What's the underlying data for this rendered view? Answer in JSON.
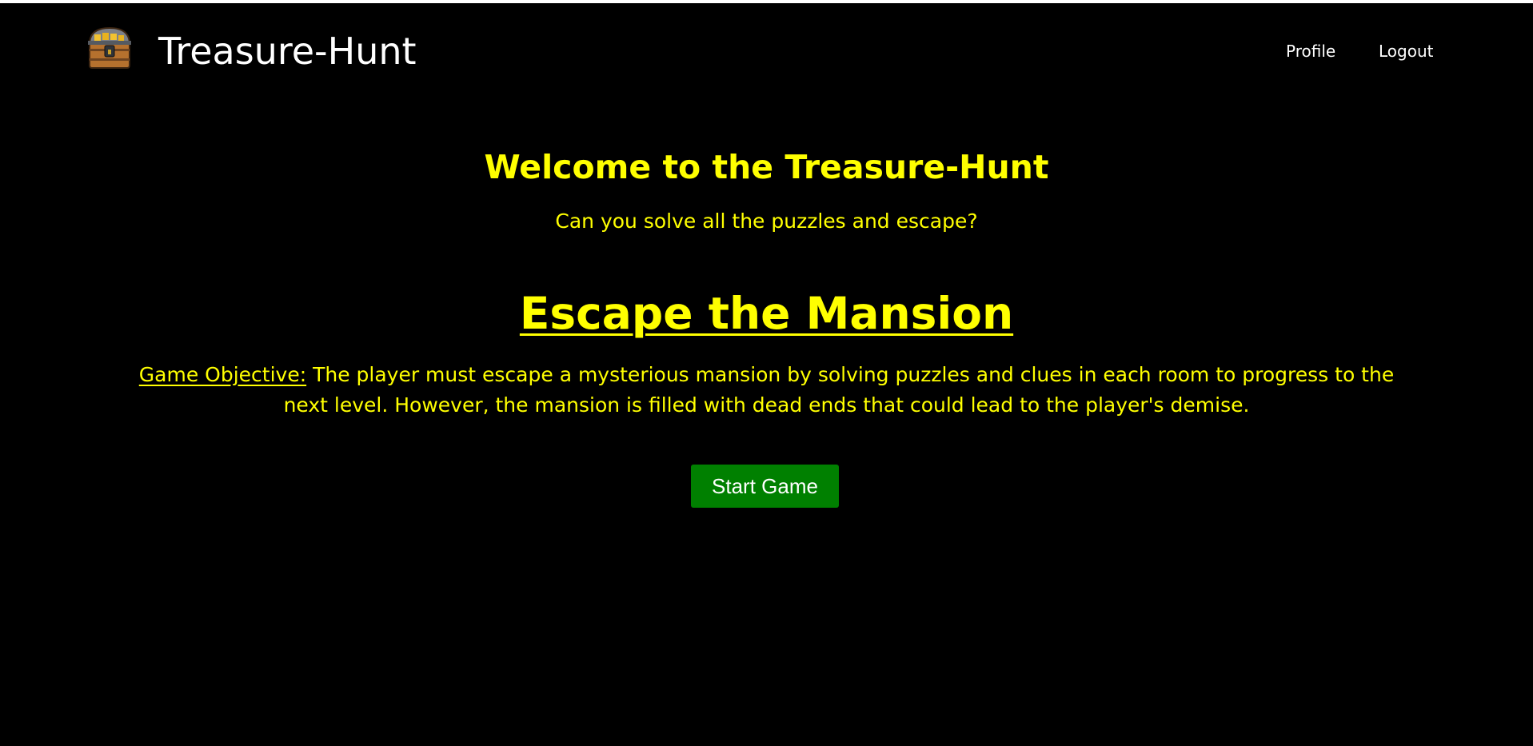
{
  "header": {
    "logo_icon": "treasure-chest-icon",
    "brand": "Treasure-Hunt",
    "nav": {
      "profile": "Profile",
      "logout": "Logout"
    }
  },
  "main": {
    "welcome": "Welcome to the Treasure-Hunt",
    "tagline": "Can you solve all the puzzles and escape?",
    "game_title": "Escape the Mansion",
    "objective_label": "Game Objective:",
    "objective_text": " The player must escape a mysterious mansion by solving puzzles and clues in each room to progress to the next level. However, the mansion is filled with dead ends that could lead to the player's demise.",
    "start_button": "Start Game"
  },
  "colors": {
    "background": "#000000",
    "text_primary": "#ffffff",
    "accent": "#ffff00",
    "button": "#008000"
  }
}
